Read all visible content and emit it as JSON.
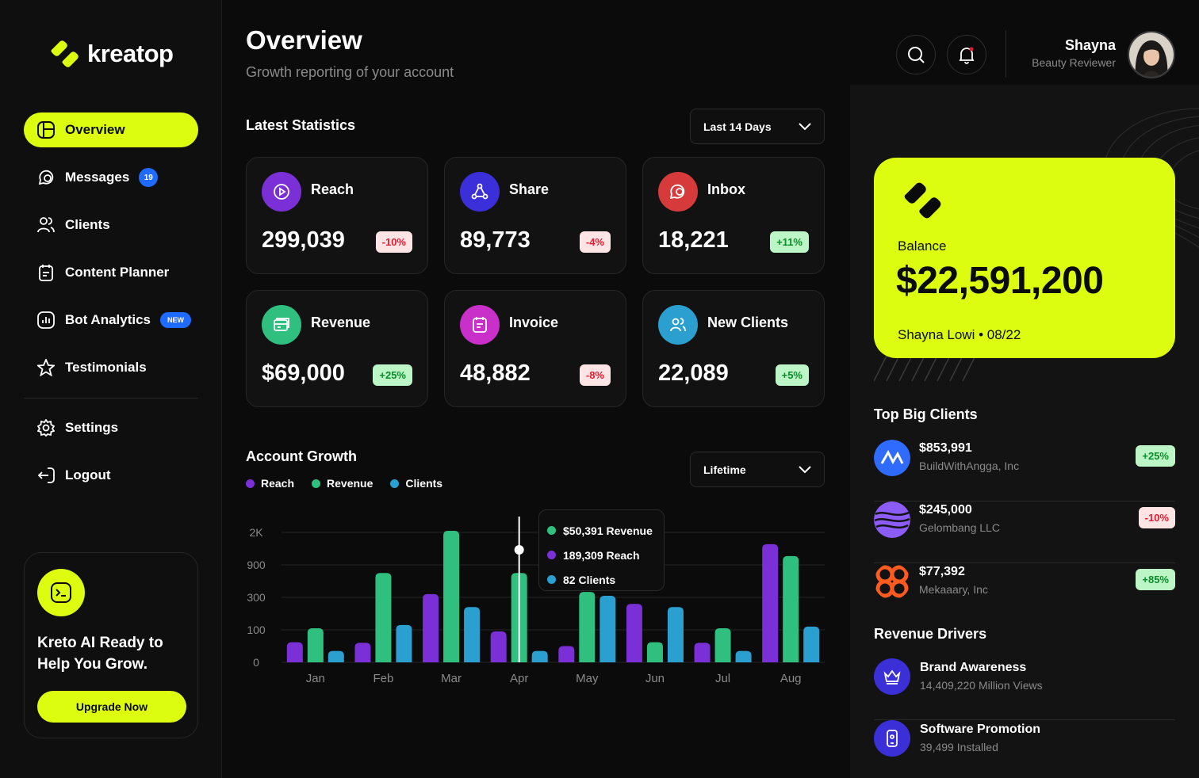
{
  "brand": {
    "name": "kreatop"
  },
  "nav": {
    "items": [
      {
        "label": "Overview"
      },
      {
        "label": "Messages",
        "badge": "19"
      },
      {
        "label": "Clients"
      },
      {
        "label": "Content Planner"
      },
      {
        "label": "Bot Analytics",
        "badge": "NEW"
      },
      {
        "label": "Testimonials"
      }
    ],
    "secondary": [
      {
        "label": "Settings"
      },
      {
        "label": "Logout"
      }
    ]
  },
  "promo": {
    "title": "Kreto AI Ready to Help You Grow.",
    "button": "Upgrade Now"
  },
  "header": {
    "title": "Overview",
    "subtitle": "Growth reporting of your account"
  },
  "user": {
    "name": "Shayna",
    "role": "Beauty Reviewer"
  },
  "stats": {
    "title": "Latest Statistics",
    "period": "Last 14 Days",
    "cards": [
      {
        "label": "Reach",
        "value": "299,039",
        "change": "-10%",
        "color": "#7b2fd6"
      },
      {
        "label": "Share",
        "value": "89,773",
        "change": "-4%",
        "color": "#3a2fd8"
      },
      {
        "label": "Inbox",
        "value": "18,221",
        "change": "+11%",
        "color": "#d63a3a"
      },
      {
        "label": "Revenue",
        "value": "$69,000",
        "change": "+25%",
        "color": "#2fbf7e"
      },
      {
        "label": "Invoice",
        "value": "48,882",
        "change": "-8%",
        "color": "#c92fc9"
      },
      {
        "label": "New Clients",
        "value": "22,089",
        "change": "+5%",
        "color": "#2a9fd0"
      }
    ]
  },
  "growth": {
    "title": "Account Growth",
    "period": "Lifetime",
    "tooltip": [
      "$50,391 Revenue",
      "189,309 Reach",
      "82 Clients"
    ]
  },
  "chart_data": {
    "type": "bar",
    "categories": [
      "Jan",
      "Feb",
      "Mar",
      "Apr",
      "May",
      "Jun",
      "Jul",
      "Aug"
    ],
    "y_ticks": [
      "0",
      "100",
      "300",
      "900",
      "2K"
    ],
    "series": [
      {
        "name": "Reach",
        "color": "#7b2fd6",
        "values": [
          62,
          60,
          360,
          95,
          50,
          260,
          60,
          1600
        ]
      },
      {
        "name": "Revenue",
        "color": "#2fbf7e",
        "values": [
          110,
          750,
          2050,
          750,
          400,
          62,
          110,
          1200
        ]
      },
      {
        "name": "Clients",
        "color": "#2a9fd0",
        "values": [
          35,
          130,
          240,
          35,
          330,
          240,
          35,
          120
        ]
      }
    ],
    "xlabel": "",
    "ylabel": "",
    "grid": true
  },
  "balance": {
    "label": "Balance",
    "value": "$22,591,200",
    "owner": "Shayna Lowi • 08/22"
  },
  "top_clients": {
    "title": "Top Big Clients",
    "items": [
      {
        "value": "$853,991",
        "name": "BuildWithAngga, Inc",
        "change": "+25%"
      },
      {
        "value": "$245,000",
        "name": "Gelombang LLC",
        "change": "-10%"
      },
      {
        "value": "$77,392",
        "name": "Mekaaary, Inc",
        "change": "+85%"
      }
    ]
  },
  "drivers": {
    "title": "Revenue Drivers",
    "items": [
      {
        "name": "Brand Awareness",
        "stat": "14,409,220 Million Views"
      },
      {
        "name": "Software Promotion",
        "stat": "39,499 Installed"
      }
    ]
  },
  "colors": {
    "accent": "#dcfd0f",
    "positive_bg": "#bdf6c6",
    "negative_bg": "#ffe4e6"
  }
}
